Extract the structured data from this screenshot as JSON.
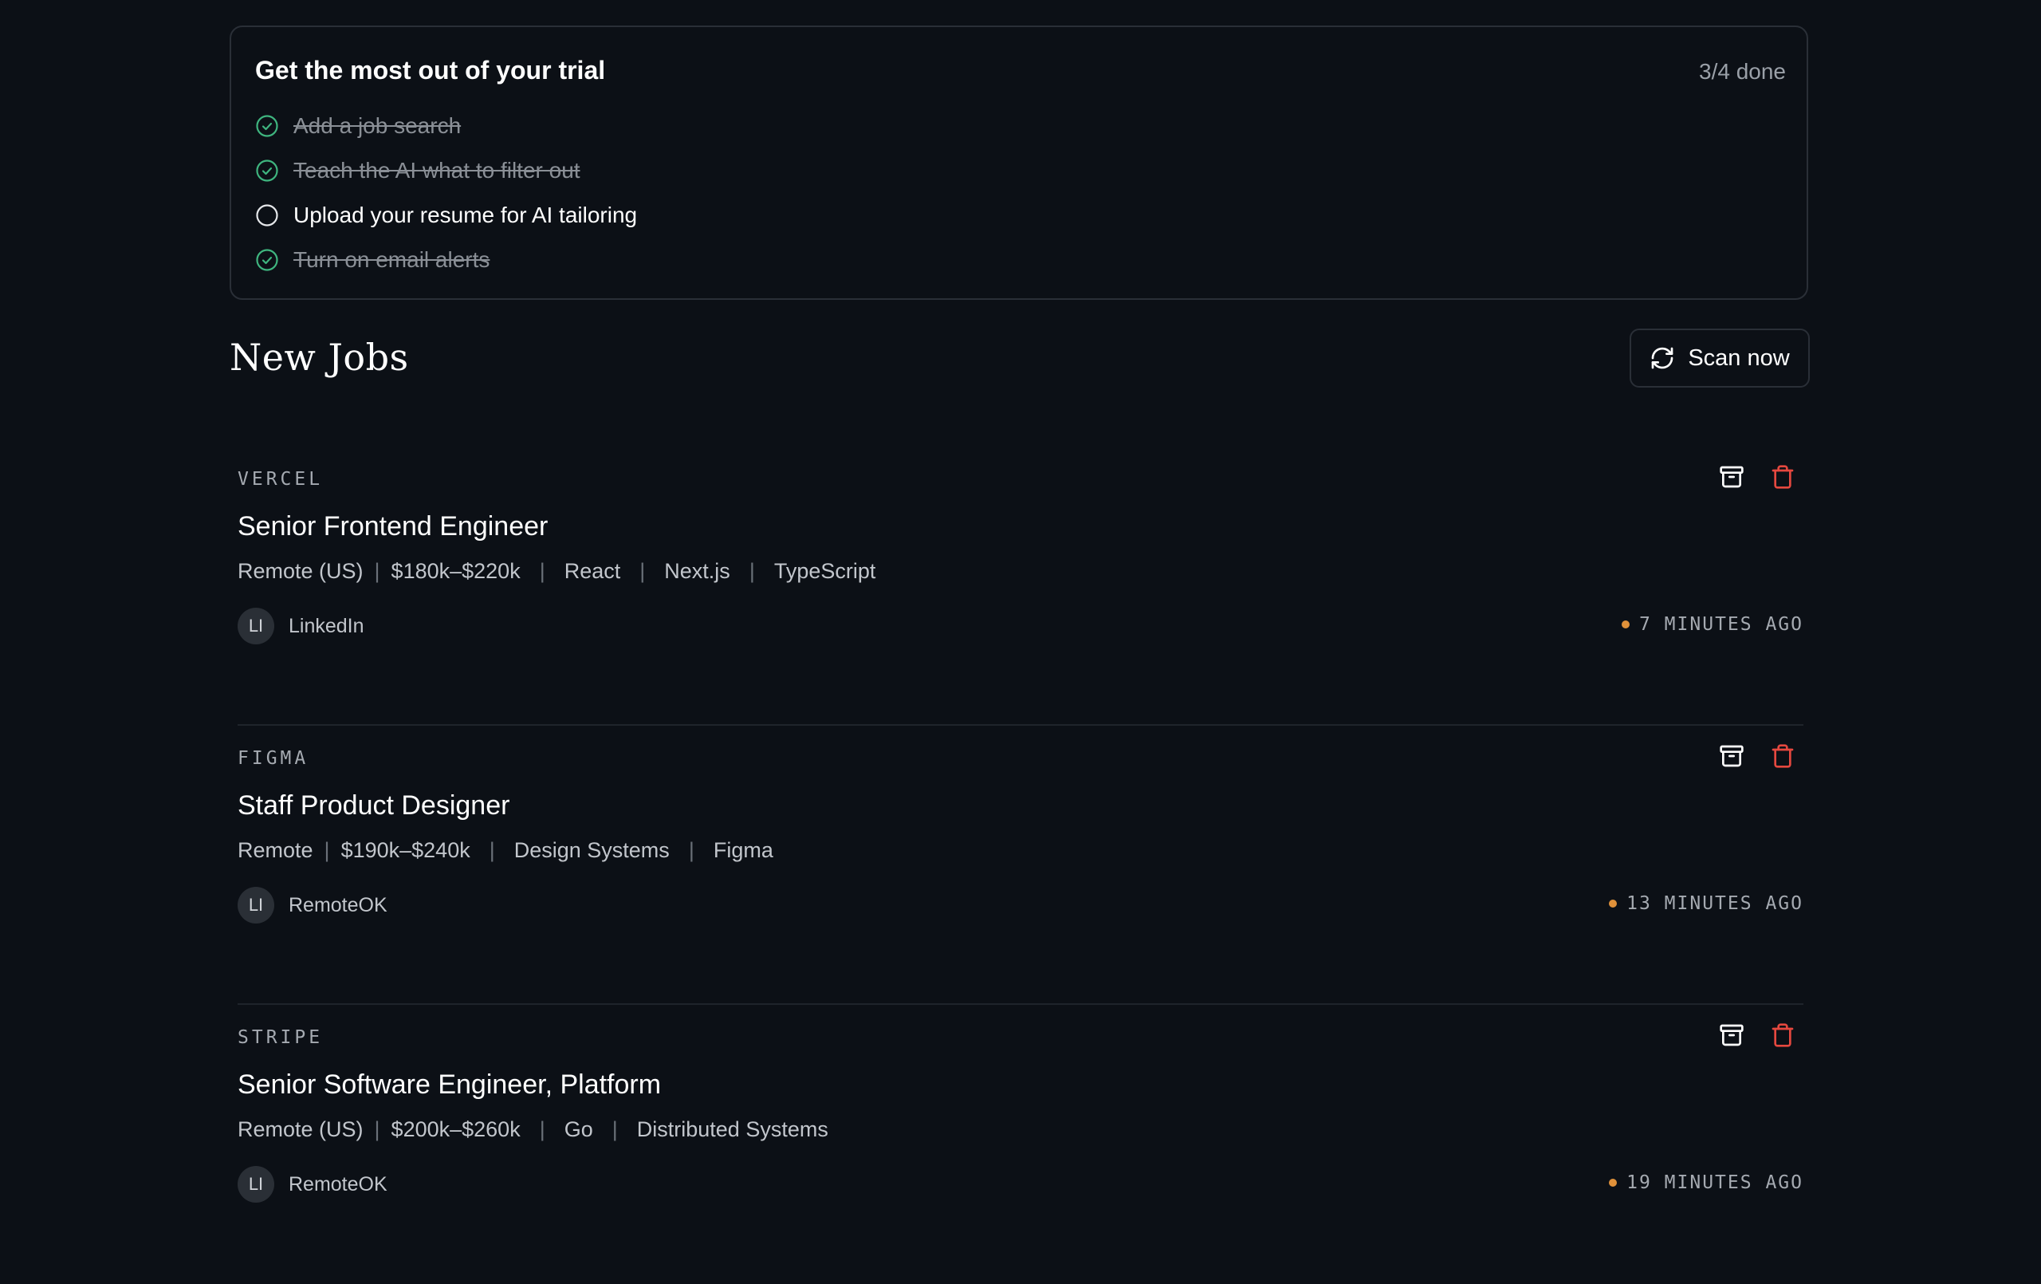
{
  "trial": {
    "title": "Get the most out of your trial",
    "progress": "3/4 done",
    "items": [
      {
        "label": "Add a job search",
        "done": true
      },
      {
        "label": "Teach the AI what to filter out",
        "done": true
      },
      {
        "label": "Upload your resume for AI tailoring",
        "done": false
      },
      {
        "label": "Turn on email alerts",
        "done": true
      }
    ]
  },
  "section": {
    "title": "New Jobs",
    "scan_label": "Scan now"
  },
  "jobs": [
    {
      "company": "VERCEL",
      "title": "Senior Frontend Engineer",
      "location": "Remote (US)",
      "salary": "$180k–$220k",
      "tags": [
        "React",
        "Next.js",
        "TypeScript"
      ],
      "source_initials": "LI",
      "source": "LinkedIn",
      "time": "7 MINUTES AGO"
    },
    {
      "company": "FIGMA",
      "title": "Staff Product Designer",
      "location": "Remote",
      "salary": "$190k–$240k",
      "tags": [
        "Design Systems",
        "Figma"
      ],
      "source_initials": "LI",
      "source": "RemoteOK",
      "time": "13 MINUTES AGO"
    },
    {
      "company": "STRIPE",
      "title": "Senior Software Engineer, Platform",
      "location": "Remote (US)",
      "salary": "$200k–$260k",
      "tags": [
        "Go",
        "Distributed Systems"
      ],
      "source_initials": "LI",
      "source": "RemoteOK",
      "time": "19 MINUTES AGO"
    }
  ],
  "colors": {
    "background": "#0c1016",
    "border": "#2a2f37",
    "check_done": "#3fb57f",
    "delete": "#e5483f",
    "time_dot": "#e0913a"
  }
}
